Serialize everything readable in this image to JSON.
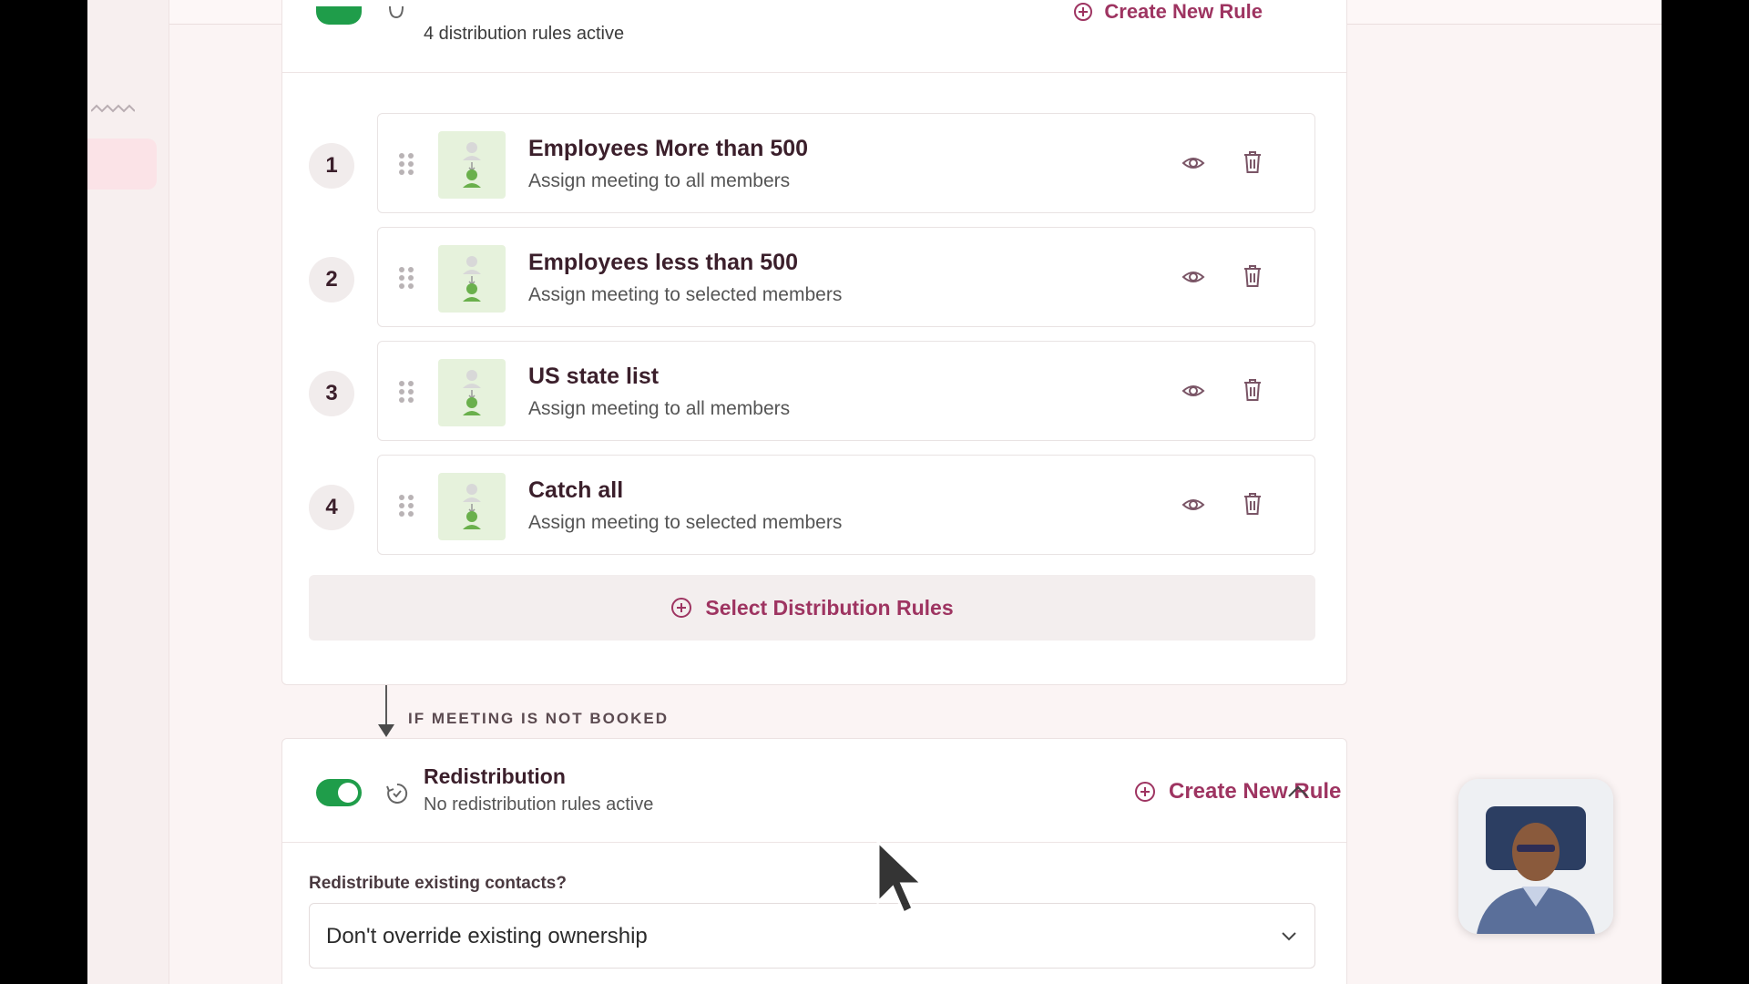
{
  "distribution": {
    "header_subtitle": "4 distribution rules active",
    "create_rule_label": "Create New Rule",
    "rules": [
      {
        "number": "1",
        "title": "Employees More than 500",
        "subtitle": "Assign meeting to all members"
      },
      {
        "number": "2",
        "title": "Employees less than 500",
        "subtitle": "Assign meeting to selected members"
      },
      {
        "number": "3",
        "title": "US state list",
        "subtitle": "Assign meeting to all members"
      },
      {
        "number": "4",
        "title": "Catch all",
        "subtitle": "Assign meeting to selected members"
      }
    ],
    "select_button_label": "Select Distribution Rules"
  },
  "connector": {
    "label": "IF MEETING IS NOT BOOKED"
  },
  "redistribution": {
    "toggle_on": true,
    "title": "Redistribution",
    "subtitle": "No redistribution rules active",
    "create_rule_label": "Create New Rule",
    "field_label": "Redistribute existing contacts?",
    "select_value": "Don't override existing ownership"
  },
  "colors": {
    "accent": "#9e3461",
    "toggle_on": "#1f9d4a",
    "avatar_bg": "#e6f2dc"
  },
  "icons": {
    "eye": "eye-icon",
    "trash": "trash-icon",
    "drag": "drag-handle-icon",
    "plus_circle": "plus-circle-icon",
    "chevron_up": "chevron-up-icon",
    "chevron_down": "chevron-down-icon"
  }
}
